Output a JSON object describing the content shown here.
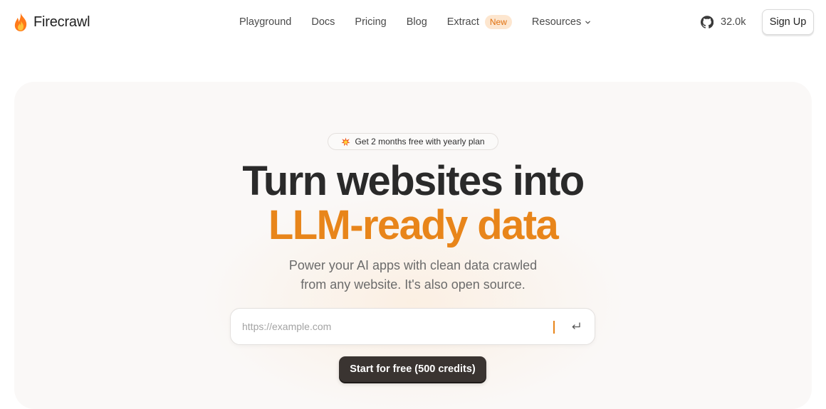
{
  "header": {
    "brand": "Firecrawl",
    "nav": [
      {
        "label": "Playground"
      },
      {
        "label": "Docs"
      },
      {
        "label": "Pricing"
      },
      {
        "label": "Blog"
      },
      {
        "label": "Extract",
        "badge": "New"
      },
      {
        "label": "Resources"
      }
    ],
    "github_stars": "32.0k",
    "signup_label": "Sign Up"
  },
  "hero": {
    "promo_text": "Get 2 months free with yearly plan",
    "headline_line1": "Turn websites into",
    "headline_line2": "LLM-ready data",
    "subtitle_line1": "Power your AI apps with clean data crawled",
    "subtitle_line2": "from any website. It's also open source.",
    "url_placeholder": "https://example.com",
    "cta_label": "Start for free (500 credits)"
  },
  "icons": {
    "logo": "flame-icon",
    "github": "github-icon",
    "promo": "sparkle-burst-icon",
    "enter": "enter-return-icon",
    "resources": "chevron-down-icon"
  },
  "colors": {
    "accent": "#e8851a",
    "badge_bg": "#fde6cf",
    "hero_bg": "#faf8f7",
    "cta_bg": "#3a3431"
  }
}
